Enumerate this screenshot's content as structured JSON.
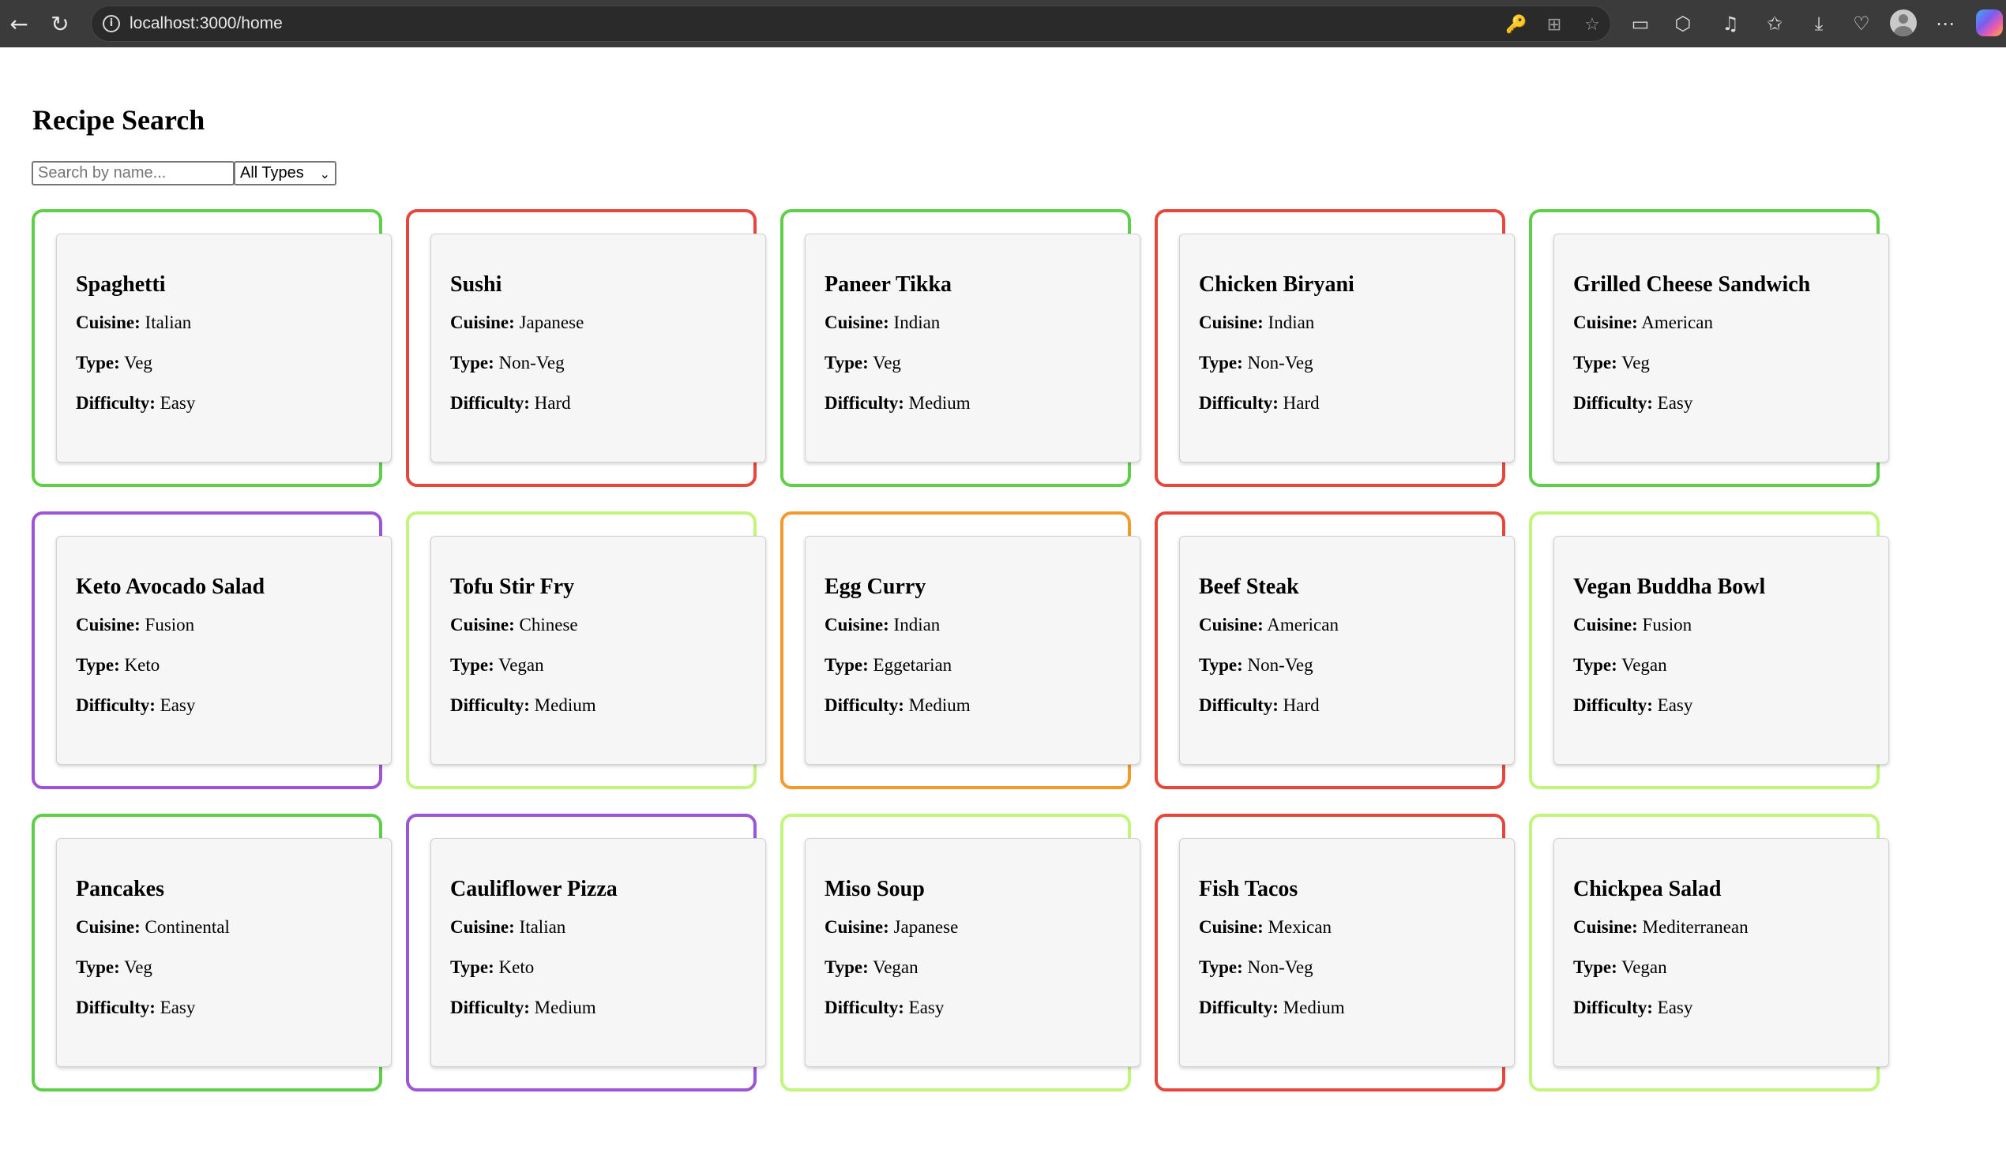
{
  "browser": {
    "url": "localhost:3000/home",
    "back_icon": "←",
    "reload_icon": "↻",
    "info_icon": "i",
    "address_icons": [
      "🔑",
      "⊞",
      "☆"
    ],
    "toolbar_icons": [
      "▭",
      "⬡",
      "♫",
      "✩",
      "⤓",
      "♡",
      "⋯"
    ]
  },
  "page": {
    "title": "Recipe Search",
    "search_placeholder": "Search by name...",
    "type_filter": "All Types",
    "labels": {
      "cuisine": "Cuisine:",
      "type": "Type:",
      "difficulty": "Difficulty:"
    }
  },
  "colors": {
    "Veg": "#5fcf4a",
    "Non-Veg": "#e5473c",
    "Keto": "#9b55d6",
    "Vegan": "#c2f57c",
    "Eggetarian": "#f39a2c"
  },
  "recipes": [
    {
      "name": "Spaghetti",
      "cuisine": "Italian",
      "type": "Veg",
      "difficulty": "Easy"
    },
    {
      "name": "Sushi",
      "cuisine": "Japanese",
      "type": "Non-Veg",
      "difficulty": "Hard"
    },
    {
      "name": "Paneer Tikka",
      "cuisine": "Indian",
      "type": "Veg",
      "difficulty": "Medium"
    },
    {
      "name": "Chicken Biryani",
      "cuisine": "Indian",
      "type": "Non-Veg",
      "difficulty": "Hard"
    },
    {
      "name": "Grilled Cheese Sandwich",
      "cuisine": "American",
      "type": "Veg",
      "difficulty": "Easy"
    },
    {
      "name": "Keto Avocado Salad",
      "cuisine": "Fusion",
      "type": "Keto",
      "difficulty": "Easy"
    },
    {
      "name": "Tofu Stir Fry",
      "cuisine": "Chinese",
      "type": "Vegan",
      "difficulty": "Medium"
    },
    {
      "name": "Egg Curry",
      "cuisine": "Indian",
      "type": "Eggetarian",
      "difficulty": "Medium"
    },
    {
      "name": "Beef Steak",
      "cuisine": "American",
      "type": "Non-Veg",
      "difficulty": "Hard"
    },
    {
      "name": "Vegan Buddha Bowl",
      "cuisine": "Fusion",
      "type": "Vegan",
      "difficulty": "Easy"
    },
    {
      "name": "Pancakes",
      "cuisine": "Continental",
      "type": "Veg",
      "difficulty": "Easy"
    },
    {
      "name": "Cauliflower Pizza",
      "cuisine": "Italian",
      "type": "Keto",
      "difficulty": "Medium"
    },
    {
      "name": "Miso Soup",
      "cuisine": "Japanese",
      "type": "Vegan",
      "difficulty": "Easy"
    },
    {
      "name": "Fish Tacos",
      "cuisine": "Mexican",
      "type": "Non-Veg",
      "difficulty": "Medium"
    },
    {
      "name": "Chickpea Salad",
      "cuisine": "Mediterranean",
      "type": "Vegan",
      "difficulty": "Easy"
    }
  ]
}
